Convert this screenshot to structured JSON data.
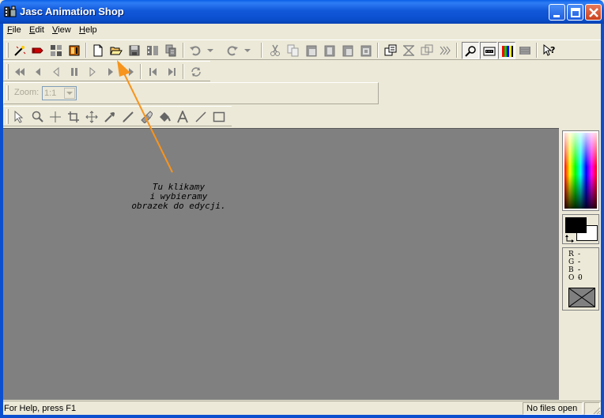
{
  "window": {
    "title": "Jasc Animation Shop"
  },
  "menu": {
    "items": [
      {
        "label": "File",
        "accel": "F",
        "rest": "ile"
      },
      {
        "label": "Edit",
        "accel": "E",
        "rest": "dit"
      },
      {
        "label": "View",
        "accel": "V",
        "rest": "iew"
      },
      {
        "label": "Help",
        "accel": "H",
        "rest": "elp"
      }
    ]
  },
  "toolbar_main": {
    "icons": [
      "animation-wizard-icon",
      "banner-wizard-icon",
      "image-effects-icon",
      "video-icon",
      "new-icon",
      "open-icon",
      "save-icon",
      "save-as-icon",
      "optimize-icon",
      "undo-icon",
      "undo-dropdown-icon",
      "redo-icon",
      "redo-dropdown-icon",
      "cut-icon",
      "copy-icon",
      "paste-new-icon",
      "paste-before-icon",
      "paste-after-icon",
      "paste-into-icon",
      "properties-icon",
      "transitions-icon",
      "effects-icon",
      "text-effects-icon",
      "zoom-view-icon",
      "view-frames-icon",
      "view-animation-icon",
      "view-onion-icon",
      "help-icon"
    ]
  },
  "toolbar_vcr": {
    "icons": [
      "first-frame-icon",
      "prev-frame-icon",
      "step-back-icon",
      "pause-icon",
      "step-forward-icon",
      "play-icon",
      "next-frame-icon",
      "prev-keyframe-icon",
      "next-keyframe-icon",
      "loop-icon"
    ]
  },
  "zoom": {
    "label": "Zoom:",
    "value": "1:1"
  },
  "toolbar_tools": {
    "icons": [
      "arrow-tool-icon",
      "zoom-tool-icon",
      "crosshair-tool-icon",
      "crop-tool-icon",
      "move-tool-icon",
      "dropper-tool-icon",
      "brush-tool-icon",
      "eraser-tool-icon",
      "fill-tool-icon",
      "text-tool-icon",
      "line-tool-icon",
      "rectangle-tool-icon"
    ]
  },
  "annotation": {
    "line1": "Tu klikamy",
    "line2": "i wybieramy",
    "line3": "obrazek do edycji.",
    "color": "#f7941d"
  },
  "color_panel": {
    "foreground": "#000000",
    "background": "#ffffff",
    "readout": [
      {
        "label": "R",
        "value": "--"
      },
      {
        "label": "G",
        "value": "--"
      },
      {
        "label": "B",
        "value": "--"
      },
      {
        "label": "O",
        "value": "0"
      }
    ]
  },
  "status": {
    "help_text": "For Help, press F1",
    "files_text": "No files open"
  },
  "colors": {
    "titlebar": "#0b4fcf",
    "workspace": "#808080",
    "chrome": "#ece9d8"
  }
}
